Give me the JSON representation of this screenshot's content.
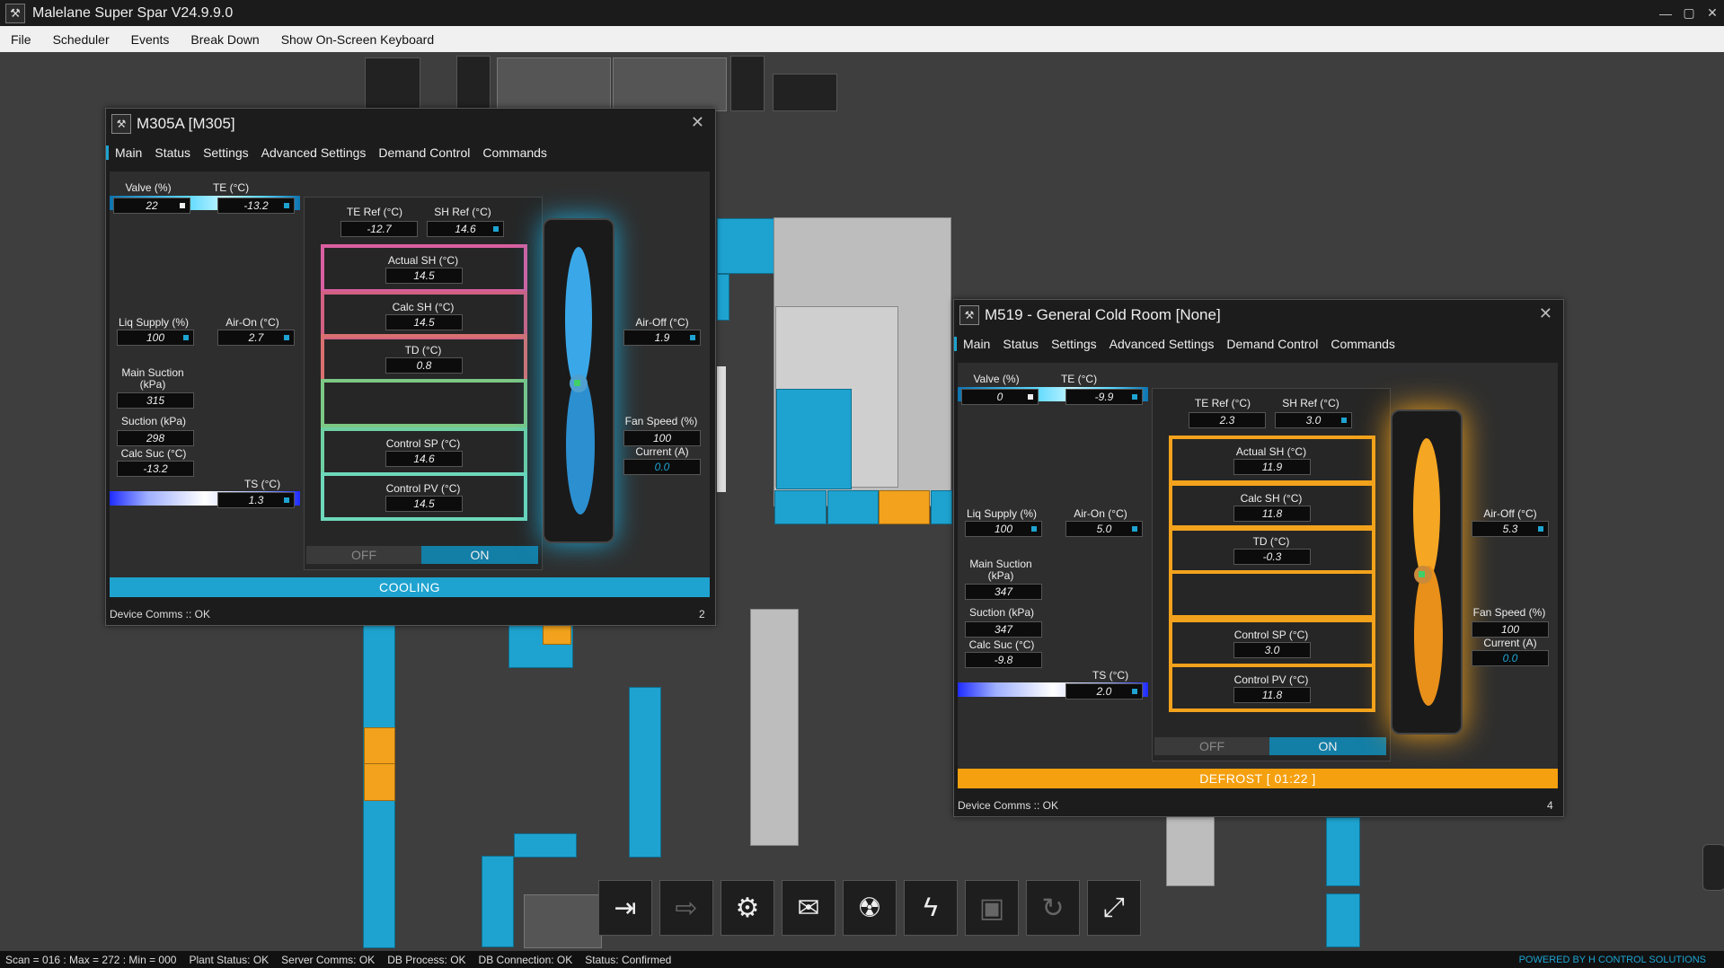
{
  "app": {
    "title": "Malelane Super Spar V24.9.9.0"
  },
  "menu": [
    "File",
    "Scheduler",
    "Events",
    "Break Down",
    "Show On-Screen Keyboard"
  ],
  "window1": {
    "title": "M305A [M305]",
    "tabs": [
      "Main",
      "Status",
      "Settings",
      "Advanced Settings",
      "Demand Control",
      "Commands"
    ],
    "labels": {
      "valve": "Valve (%)",
      "te": "TE (°C)",
      "te_ref": "TE Ref (°C)",
      "sh_ref": "SH Ref (°C)",
      "actual_sh": "Actual SH (°C)",
      "calc_sh": "Calc SH (°C)",
      "td": "TD (°C)",
      "control_sp": "Control SP (°C)",
      "control_pv": "Control PV (°C)",
      "liq_supply": "Liq Supply (%)",
      "air_on": "Air-On (°C)",
      "air_off": "Air-Off (°C)",
      "main_suction": "Main Suction (kPa)",
      "suction": "Suction (kPa)",
      "calc_suc": "Calc Suc (°C)",
      "ts": "TS (°C)",
      "fan_speed": "Fan Speed (%)",
      "current": "Current (A)"
    },
    "values": {
      "valve": "22",
      "te": "-13.2",
      "te_ref": "-12.7",
      "sh_ref": "14.6",
      "actual_sh": "14.5",
      "calc_sh": "14.5",
      "td": "0.8",
      "control_sp": "14.6",
      "control_pv": "14.5",
      "liq_supply": "100",
      "air_on": "2.7",
      "air_off": "1.9",
      "main_suction": "315",
      "suction": "298",
      "calc_suc": "-13.2",
      "ts": "1.3",
      "fan_speed": "100",
      "current": "0.0"
    },
    "off_label": "OFF",
    "on_label": "ON",
    "status": "COOLING",
    "status_color": "#1ea3d0",
    "comms": "Device Comms :: OK",
    "page": "2"
  },
  "window2": {
    "title": "M519 - General Cold Room [None]",
    "tabs": [
      "Main",
      "Status",
      "Settings",
      "Advanced Settings",
      "Demand Control",
      "Commands"
    ],
    "labels": {
      "valve": "Valve (%)",
      "te": "TE (°C)",
      "te_ref": "TE Ref (°C)",
      "sh_ref": "SH Ref (°C)",
      "actual_sh": "Actual SH (°C)",
      "calc_sh": "Calc SH (°C)",
      "td": "TD (°C)",
      "control_sp": "Control SP (°C)",
      "control_pv": "Control PV (°C)",
      "liq_supply": "Liq Supply (%)",
      "air_on": "Air-On (°C)",
      "air_off": "Air-Off (°C)",
      "main_suction": "Main Suction (kPa)",
      "suction": "Suction (kPa)",
      "calc_suc": "Calc Suc (°C)",
      "ts": "TS (°C)",
      "fan_speed": "Fan Speed (%)",
      "current": "Current (A)"
    },
    "values": {
      "valve": "0",
      "te": "-9.9",
      "te_ref": "2.3",
      "sh_ref": "3.0",
      "actual_sh": "11.9",
      "calc_sh": "11.8",
      "td": "-0.3",
      "control_sp": "3.0",
      "control_pv": "11.8",
      "liq_supply": "100",
      "air_on": "5.0",
      "air_off": "5.3",
      "main_suction": "347",
      "suction": "347",
      "calc_suc": "-9.8",
      "ts": "2.0",
      "fan_speed": "100",
      "current": "0.0"
    },
    "off_label": "OFF",
    "on_label": "ON",
    "status": "DEFROST [ 01:22 ]",
    "status_color": "#f5a00f",
    "comms": "Device Comms :: OK",
    "page": "4"
  },
  "footer": {
    "scan": "Scan = 016 : Max = 272 : Min = 000",
    "plant": "Plant Status: OK",
    "server": "Server Comms: OK",
    "db_process": "DB Process:   OK",
    "db_conn": "DB Connection:  OK",
    "status": "Status:  Confirmed",
    "powered": "POWERED BY H CONTROL SOLUTIONS"
  },
  "toolbar_icons": [
    "login-icon",
    "logout-icon",
    "user-settings-icon",
    "mail-icon",
    "alarm-icon",
    "lightning-icon",
    "save-icon",
    "refresh-icon",
    "expand-icon"
  ],
  "colors": {
    "cooling": "#1ea3d0",
    "defrost": "#f5a00f",
    "accent": "#1ea3d0"
  }
}
